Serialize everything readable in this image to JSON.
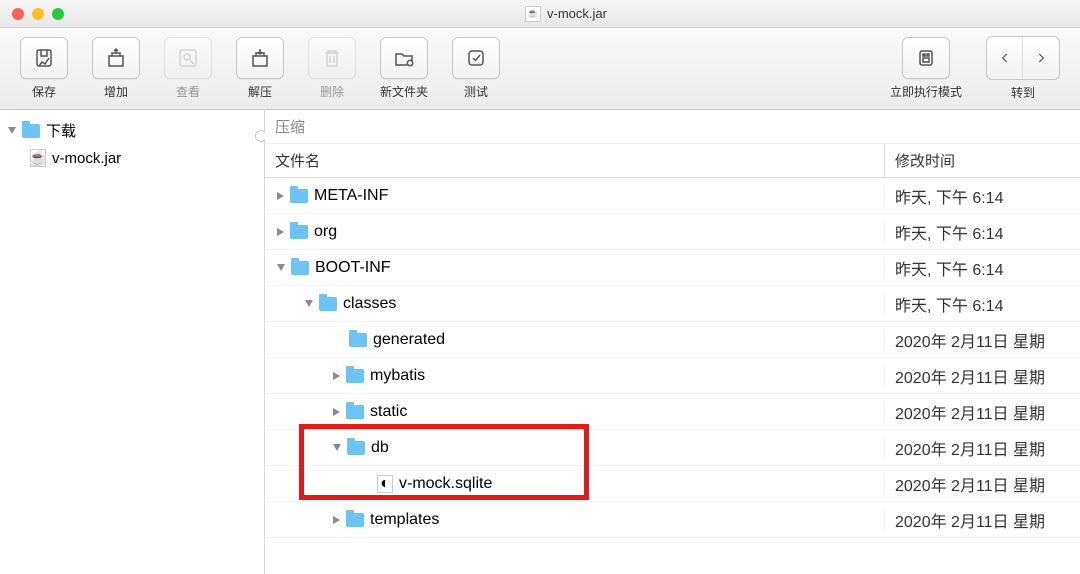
{
  "window_title": "v-mock.jar",
  "toolbar": {
    "save": "保存",
    "add": "增加",
    "view": "查看",
    "extract": "解压",
    "delete": "删除",
    "new_folder": "新文件夹",
    "test": "测试",
    "exec_mode": "立即执行模式",
    "goto": "转到"
  },
  "sidebar": {
    "root": "下载",
    "file": "v-mock.jar"
  },
  "main": {
    "breadcrumb": "压缩",
    "col_name": "文件名",
    "col_date": "修改时间",
    "rows": [
      {
        "name": "META-INF",
        "date": "昨天, 下午 6:14",
        "level": 0,
        "type": "folder",
        "expand": "closed"
      },
      {
        "name": "org",
        "date": "昨天, 下午 6:14",
        "level": 0,
        "type": "folder",
        "expand": "closed"
      },
      {
        "name": "BOOT-INF",
        "date": "昨天, 下午 6:14",
        "level": 0,
        "type": "folder",
        "expand": "open"
      },
      {
        "name": "classes",
        "date": "昨天, 下午 6:14",
        "level": 1,
        "type": "folder",
        "expand": "open"
      },
      {
        "name": "generated",
        "date": "2020年 2月11日 星期",
        "level": 2,
        "type": "folder",
        "expand": "none"
      },
      {
        "name": "mybatis",
        "date": "2020年 2月11日 星期",
        "level": 2,
        "type": "folder",
        "expand": "closed"
      },
      {
        "name": "static",
        "date": "2020年 2月11日 星期",
        "level": 2,
        "type": "folder",
        "expand": "closed"
      },
      {
        "name": "db",
        "date": "2020年 2月11日 星期",
        "level": 2,
        "type": "folder",
        "expand": "open"
      },
      {
        "name": "v-mock.sqlite",
        "date": "2020年 2月11日 星期",
        "level": 3,
        "type": "file",
        "expand": "none"
      },
      {
        "name": "templates",
        "date": "2020年 2月11日 星期",
        "level": 2,
        "type": "folder",
        "expand": "closed"
      }
    ]
  },
  "highlight": {
    "rows_from": 7,
    "rows_to": 8
  },
  "colors": {
    "folder": "#6ec3f5",
    "highlight": "#e11b1b"
  }
}
